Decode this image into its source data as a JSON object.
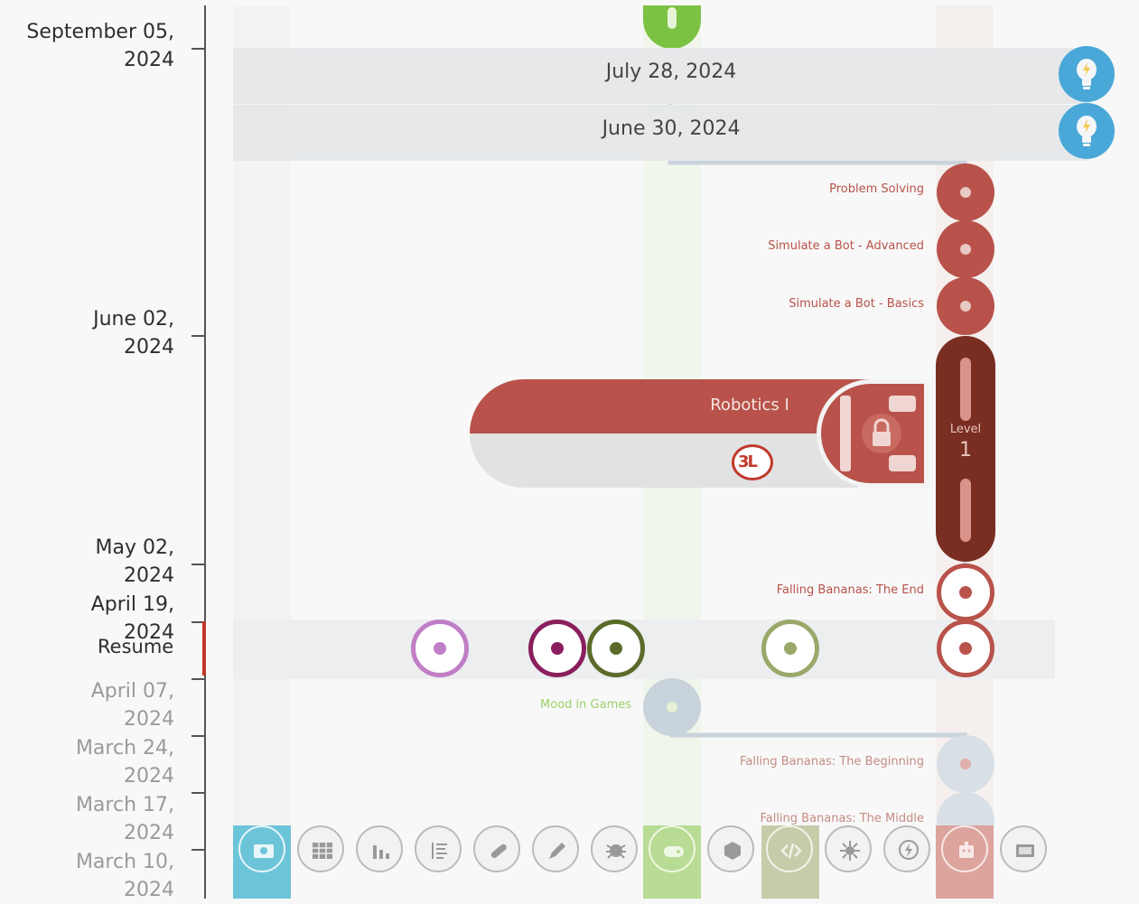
{
  "timeline_dates": [
    {
      "label": "September 05,\n2024"
    },
    {
      "label": "June 02,\n2024"
    },
    {
      "label": "May 02,\n2024"
    },
    {
      "label": "April 19,\n2024"
    },
    {
      "label": "April 07,\n2024"
    },
    {
      "label": "March 24,\n2024"
    },
    {
      "label": "March 17,\n2024"
    },
    {
      "label": "March 10,\n2024"
    }
  ],
  "resume_label": "Resume",
  "banners": [
    {
      "date": "July 28,  2024",
      "icon": "lightbulb-icon"
    },
    {
      "date": "June 30,  2024",
      "icon": "lightbulb-icon"
    }
  ],
  "lessons": [
    {
      "title": "Problem Solving"
    },
    {
      "title": "Simulate a Bot - Advanced"
    },
    {
      "title": "Simulate a Bot - Basics"
    },
    {
      "title": "Falling Bananas: The End"
    },
    {
      "title": "Mood in Games"
    },
    {
      "title": "Falling Bananas: The Beginning"
    },
    {
      "title": "Falling Bananas: The Middle"
    }
  ],
  "course_card": {
    "title": "Robotics I",
    "badge": "3L",
    "icon": "robot-lock-icon"
  },
  "level": {
    "label": "Level",
    "value": "1"
  },
  "colors": {
    "robotics": "#b8524a",
    "robotics_dark": "#7a2e22",
    "green": "#7cc242",
    "purple_light": "#c07ec6",
    "purple_dark": "#8a1f5e",
    "olive": "#5b6b2a",
    "olive_light": "#9aa86a",
    "blue": "#4aa8d8",
    "gray_node": "#c9d3db"
  },
  "bottom_toolbar": [
    {
      "icon": "photo-icon"
    },
    {
      "icon": "grid-icon"
    },
    {
      "icon": "bar-chart-icon"
    },
    {
      "icon": "list-icon"
    },
    {
      "icon": "link-icon"
    },
    {
      "icon": "pencil-icon"
    },
    {
      "icon": "bug-icon"
    },
    {
      "icon": "game-controller-icon"
    },
    {
      "icon": "hexagon-icon"
    },
    {
      "icon": "code-icon"
    },
    {
      "icon": "virus-icon"
    },
    {
      "icon": "lightning-icon"
    },
    {
      "icon": "robot-icon"
    },
    {
      "icon": "screen-icon"
    }
  ]
}
